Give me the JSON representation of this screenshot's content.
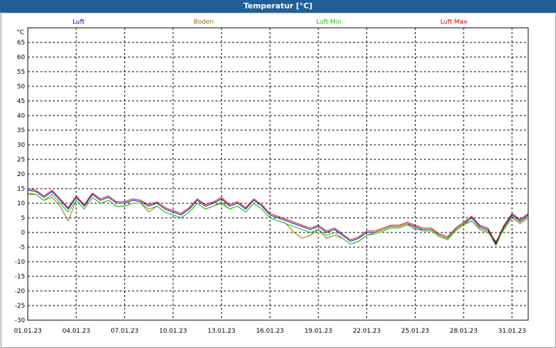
{
  "window": {
    "title": "Temperatur [°C]"
  },
  "chart_data": {
    "type": "line",
    "title": "Temperatur [°C]",
    "ylabel": "°C",
    "xlabel": "",
    "ylim": [
      -30,
      70
    ],
    "yticks": [
      65,
      60,
      55,
      50,
      45,
      40,
      35,
      30,
      25,
      20,
      15,
      10,
      5,
      0,
      -5,
      -10,
      -15,
      -20,
      -25,
      -30
    ],
    "xlim": [
      "01.01.23",
      "01.02.23"
    ],
    "xtick_labels": [
      "01.01.23",
      "04.01.23",
      "07.01.23",
      "10.01.23",
      "13.01.23",
      "16.01.23",
      "19.01.23",
      "22.01.23",
      "25.01.23",
      "28.01.23",
      "31.01.23"
    ],
    "grid": true,
    "legend_position": "top",
    "x": [
      "01.01.23 00:00",
      "01.01.23 12:00",
      "02.01.23 00:00",
      "02.01.23 12:00",
      "03.01.23 00:00",
      "03.01.23 12:00",
      "04.01.23 00:00",
      "04.01.23 12:00",
      "05.01.23 00:00",
      "05.01.23 12:00",
      "06.01.23 00:00",
      "06.01.23 12:00",
      "07.01.23 00:00",
      "07.01.23 12:00",
      "08.01.23 00:00",
      "08.01.23 12:00",
      "09.01.23 00:00",
      "09.01.23 12:00",
      "10.01.23 00:00",
      "10.01.23 12:00",
      "11.01.23 00:00",
      "11.01.23 12:00",
      "12.01.23 00:00",
      "12.01.23 12:00",
      "13.01.23 00:00",
      "13.01.23 12:00",
      "14.01.23 00:00",
      "14.01.23 12:00",
      "15.01.23 00:00",
      "15.01.23 12:00",
      "16.01.23 00:00",
      "16.01.23 12:00",
      "17.01.23 00:00",
      "17.01.23 12:00",
      "18.01.23 00:00",
      "18.01.23 12:00",
      "19.01.23 00:00",
      "19.01.23 12:00",
      "20.01.23 00:00",
      "20.01.23 12:00",
      "21.01.23 00:00",
      "21.01.23 12:00",
      "22.01.23 00:00",
      "22.01.23 12:00",
      "23.01.23 00:00",
      "23.01.23 12:00",
      "24.01.23 00:00",
      "24.01.23 12:00",
      "25.01.23 00:00",
      "25.01.23 12:00",
      "26.01.23 00:00",
      "26.01.23 12:00",
      "27.01.23 00:00",
      "27.01.23 12:00",
      "28.01.23 00:00",
      "28.01.23 12:00",
      "29.01.23 00:00",
      "29.01.23 12:00",
      "30.01.23 00:00",
      "30.01.23 12:00",
      "31.01.23 00:00",
      "31.01.23 12:00",
      "01.02.23 00:00"
    ],
    "series": [
      {
        "name": "Luft",
        "color": "#0000cc",
        "values": [
          14.5,
          14,
          12,
          14,
          11,
          8,
          12,
          9,
          13,
          11,
          12,
          10,
          10,
          11,
          10.5,
          9,
          10,
          8,
          7,
          6,
          8,
          11,
          9,
          10,
          11.5,
          9,
          10,
          8,
          11,
          9,
          6,
          5,
          4,
          3,
          2,
          1,
          2,
          0,
          1,
          -1,
          -3,
          -2,
          0,
          0,
          1,
          2,
          2,
          3,
          2,
          1,
          1,
          -1,
          -2,
          1,
          3,
          5,
          2,
          1,
          -4,
          2,
          6,
          4,
          6
        ]
      },
      {
        "name": "Boden",
        "color": "#996600",
        "values": [
          13,
          13,
          11,
          12,
          9,
          4,
          11,
          8,
          12,
          10,
          11,
          9,
          9,
          10,
          10,
          7,
          9,
          7,
          6,
          5,
          7,
          10,
          8,
          9,
          10,
          8,
          9,
          7,
          10,
          8,
          5,
          4,
          3,
          0,
          -2,
          -1,
          1,
          -2,
          -1,
          -2,
          -4,
          -3,
          -1,
          0,
          1,
          2,
          2,
          3,
          1,
          1,
          1,
          -1,
          -2,
          1,
          3,
          4,
          1,
          0,
          -3,
          1,
          5,
          3,
          5
        ]
      },
      {
        "name": "Luft Min",
        "color": "#00cc00",
        "values": [
          13.5,
          13,
          11,
          13,
          10,
          7,
          11,
          8,
          12,
          10,
          11,
          9,
          9,
          10,
          10,
          8,
          9,
          7,
          6,
          5,
          7,
          10,
          8,
          9,
          10.5,
          8,
          9,
          7,
          10,
          8,
          5,
          4,
          3,
          2,
          1,
          0,
          1,
          -1,
          0,
          -2,
          -4,
          -3,
          -1,
          -0.5,
          0.5,
          1.5,
          1.5,
          2.5,
          1.5,
          0.5,
          0.5,
          -1.5,
          -2.5,
          0.5,
          2.5,
          4,
          1.5,
          0.5,
          -4.5,
          1.5,
          5.5,
          3.5,
          5.5
        ]
      },
      {
        "name": "Luft Max",
        "color": "#cc0000",
        "values": [
          15,
          14.5,
          12.5,
          14.5,
          11.5,
          8.5,
          12.5,
          9.5,
          13.5,
          11.5,
          12.5,
          10.5,
          10.5,
          11.5,
          11,
          9.5,
          10.5,
          8.5,
          7.5,
          6.5,
          8.5,
          11.5,
          9.5,
          10.5,
          12,
          9.5,
          10.5,
          8.5,
          11.5,
          9.5,
          6.5,
          5.5,
          4.5,
          3.5,
          2.5,
          1.5,
          2.5,
          0.5,
          1.5,
          -0.5,
          -2.5,
          -1.5,
          0.5,
          0.5,
          1.5,
          2.5,
          2.5,
          3.5,
          2.5,
          1.5,
          1.5,
          -0.5,
          -1.5,
          1.5,
          3.5,
          5.5,
          2.5,
          1.5,
          -3.5,
          2.5,
          6.5,
          4.5,
          6.5
        ]
      }
    ]
  }
}
